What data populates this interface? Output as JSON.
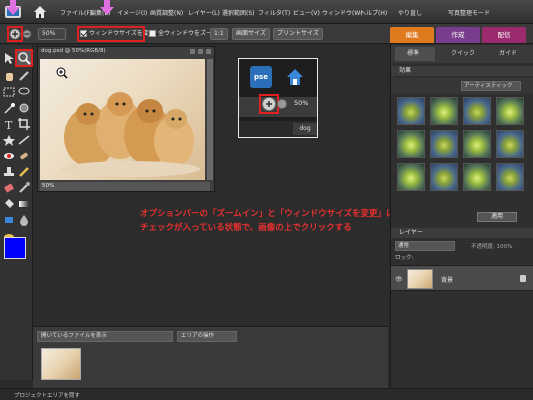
{
  "menubar": {
    "items": [
      "ファイル(F)",
      "編集(E)",
      "イメージ(I)",
      "画質調整(N)",
      "レイヤー(L)",
      "選択範囲(S)",
      "フィルタ(T)",
      "ビュー(V)",
      "ウィンドウ(W)",
      "ヘルプ(H)"
    ],
    "rotate_label": "やり直し",
    "mode_label": "写真整理モード"
  },
  "optionbar": {
    "zoom_value": "50%",
    "resize_window_label": "ウィンドウサイズを変更",
    "resize_window_checked": true,
    "zoom_all_windows_label": "全ウィンドウをズーム",
    "zoom_all_windows_checked": false,
    "actual_pixels_label": "1:1",
    "fit_screen_label": "画面サイズ",
    "print_size_label": "プリントサイズ"
  },
  "mode_tabs": [
    {
      "label": "編集",
      "color": "#e07a1f"
    },
    {
      "label": "作成",
      "color": "#7a3c8c"
    },
    {
      "label": "配信",
      "color": "#9a2b6e"
    }
  ],
  "document": {
    "title": "dog.psd @ 50%(RGB/8)",
    "zoom_status": "50%"
  },
  "callout": {
    "logo": "pse",
    "zoom_percent": "50%",
    "doc_tab": "dog"
  },
  "note": {
    "line1": "オプションバーの「ズームイン」と「ウィンドウサイズを変更」に",
    "line2": "チェックが入っている状態で、画像の上でクリックする"
  },
  "project_bin": {
    "select_label": "開いているファイルを表示",
    "actions_label": "エリアの操作"
  },
  "statusbar": {
    "label": "プロジェクトエリアを隠す"
  },
  "right_panel": {
    "tabs": [
      "標準",
      "クイック",
      "ガイド"
    ],
    "effects_header": "効果",
    "effects_dropdown": "アーティスティック",
    "apply_button": "適用",
    "layers_header": "レイヤー",
    "blend_mode": "通常",
    "opacity_label": "不透明度: 100%",
    "lock_label": "ロック:",
    "layer_name": "背景"
  },
  "colors": {
    "foreground": "#0000ff",
    "background": "#000000",
    "annotation": "#e83030",
    "arrow": "#e070e0"
  }
}
